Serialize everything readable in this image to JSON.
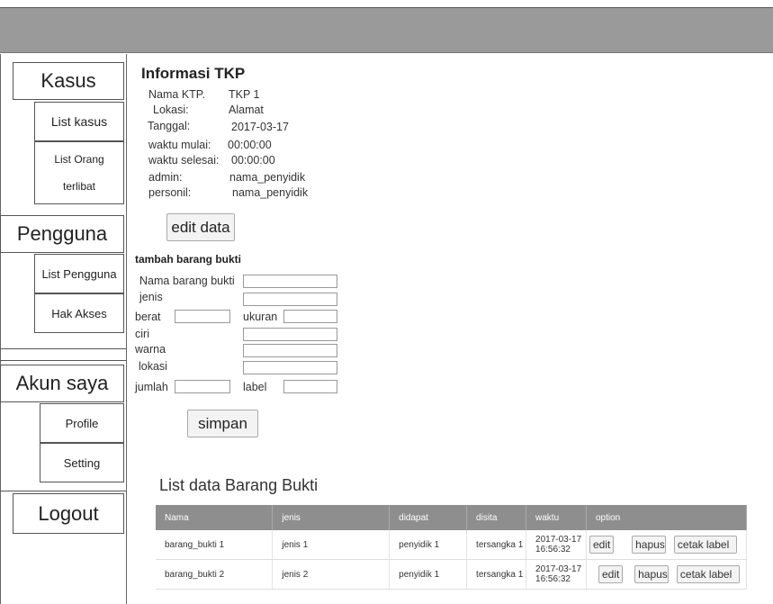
{
  "sidebar": {
    "kasus": "Kasus",
    "list_kasus": "List kasus",
    "list_orang_1": "List Orang",
    "list_orang_2": "terlibat",
    "pengguna": "Pengguna",
    "list_pengguna": "List Pengguna",
    "hak_akses": "Hak Akses",
    "akun_saya": "Akun saya",
    "profile": "Profile",
    "setting": "Setting",
    "logout": "Logout"
  },
  "info": {
    "title": "Informasi TKP",
    "nama_label": "Nama KTP.",
    "nama_value": "TKP 1",
    "lokasi_label": "Lokasi:",
    "lokasi_value": "Alamat",
    "tanggal_label": "Tanggal:",
    "tanggal_value": "2017-03-17",
    "mulai_label": "waktu mulai:",
    "mulai_value": "00:00:00",
    "selesai_label": "waktu selesai:",
    "selesai_value": "00:00:00",
    "admin_label": "admin:",
    "admin_value": "nama_penyidik",
    "personil_label": "personil:",
    "personil_value": "nama_penyidik",
    "edit_button": "edit data"
  },
  "form": {
    "title": "tambah barang bukti",
    "nama_barang": "Nama barang bukti",
    "jenis": "jenis",
    "berat": "berat",
    "ukuran": "ukuran",
    "ciri": "ciri",
    "warna": "warna",
    "lokasi": "lokasi",
    "jumlah": "jumlah",
    "label": "label",
    "simpan": "simpan"
  },
  "list": {
    "title": "List data Barang Bukti",
    "headers": [
      "Nama",
      "jenis",
      "didapat",
      "disita",
      "waktu",
      "option"
    ],
    "rows": [
      {
        "nama": "barang_bukti 1",
        "jenis": "jenis 1",
        "didapat": "penyidik 1",
        "disita": "tersangka 1",
        "waktu": "2017-03-17 16:56:32"
      },
      {
        "nama": "barang_bukti 2",
        "jenis": "jenis 2",
        "didapat": "penyidik 1",
        "disita": "tersangka 1",
        "waktu": "2017-03-17 16:56:32"
      }
    ],
    "btn_edit": "edit",
    "btn_hapus": "hapus",
    "btn_cetak": "cetak label"
  }
}
